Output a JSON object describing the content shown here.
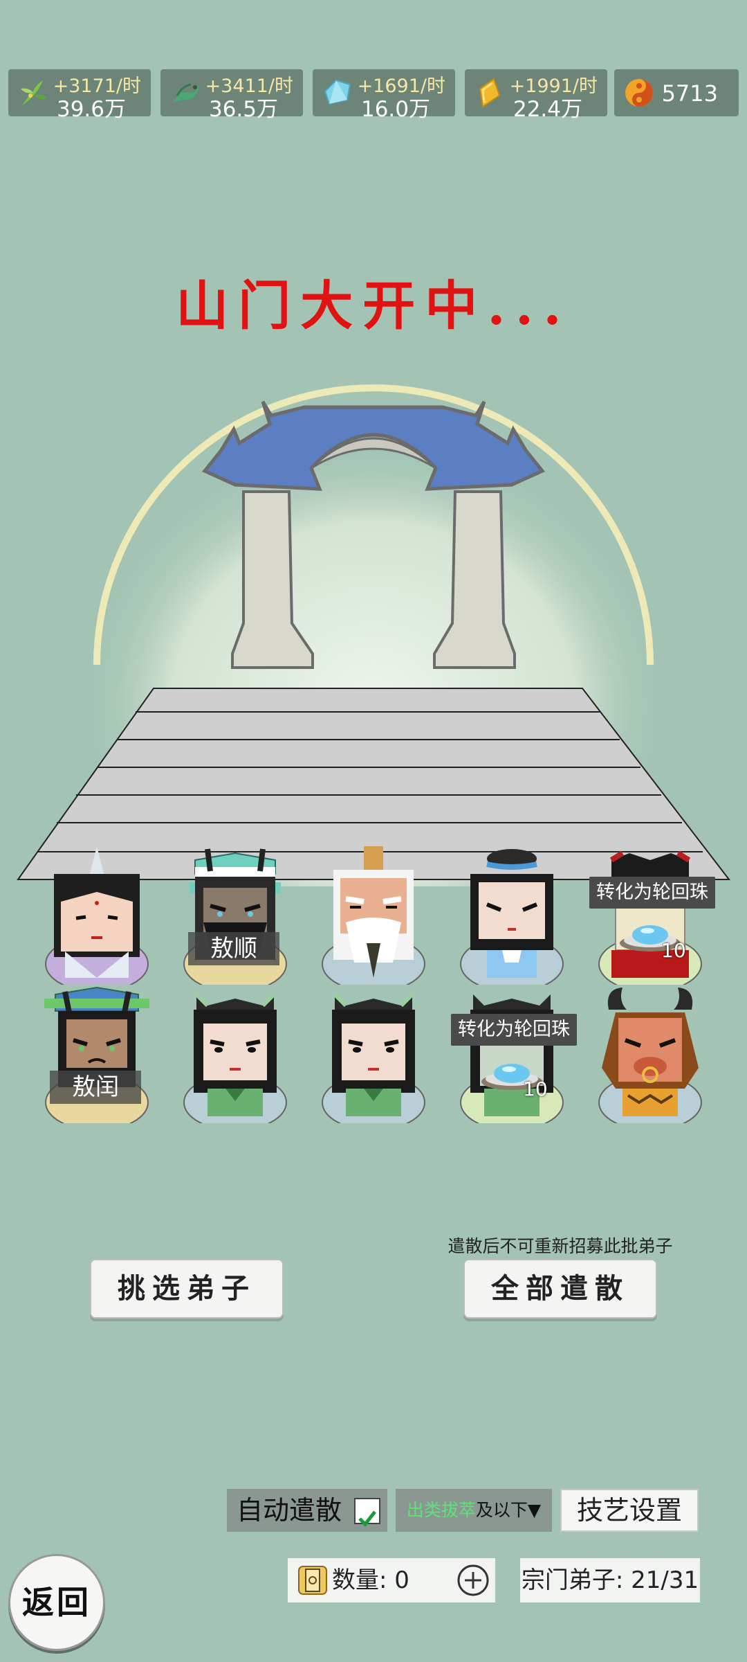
{
  "resources": [
    {
      "icon": "herb-icon",
      "rate": "+3171/时",
      "total": "39.6万"
    },
    {
      "icon": "dragon-grass-icon",
      "rate": "+3411/时",
      "total": "36.5万"
    },
    {
      "icon": "crystal-icon",
      "rate": "+1691/时",
      "total": "16.0万"
    },
    {
      "icon": "gold-ingot-icon",
      "rate": "+1991/时",
      "total": "22.4万"
    },
    {
      "icon": "spirit-orb-icon",
      "value": "5713"
    }
  ],
  "title": "山门大开中...",
  "disciples": {
    "row1": [
      {
        "name": "",
        "label": ""
      },
      {
        "name": "敖顺",
        "label": ""
      },
      {
        "name": "",
        "label": ""
      },
      {
        "name": "",
        "label": ""
      },
      {
        "name": "",
        "label": "转化为轮回珠",
        "orb_count": "10"
      }
    ],
    "row2": [
      {
        "name": "敖闰",
        "label": ""
      },
      {
        "name": "",
        "label": ""
      },
      {
        "name": "",
        "label": ""
      },
      {
        "name": "",
        "label": "转化为轮回珠",
        "orb_count": "10"
      },
      {
        "name": "",
        "label": ""
      }
    ]
  },
  "actions": {
    "select_label": "挑选弟子",
    "dismiss_all_label": "全部遣散",
    "dismiss_hint": "遣散后不可重新招募此批弟子"
  },
  "settings": {
    "auto_dismiss_label": "自动遣散",
    "auto_dismiss_checked": true,
    "filter_highlight": "出类拔萃",
    "filter_suffix": "及以下▼",
    "skill_label": "技艺设置",
    "quantity_label": "数量: 0",
    "members_label": "宗门弟子: 21/31"
  },
  "colors": {
    "background": "#a3c4b4",
    "title": "#e01212",
    "filter_highlight": "#5fe07a",
    "resource_rate": "#f6e8a3"
  },
  "nav": {
    "back_label": "返回"
  }
}
